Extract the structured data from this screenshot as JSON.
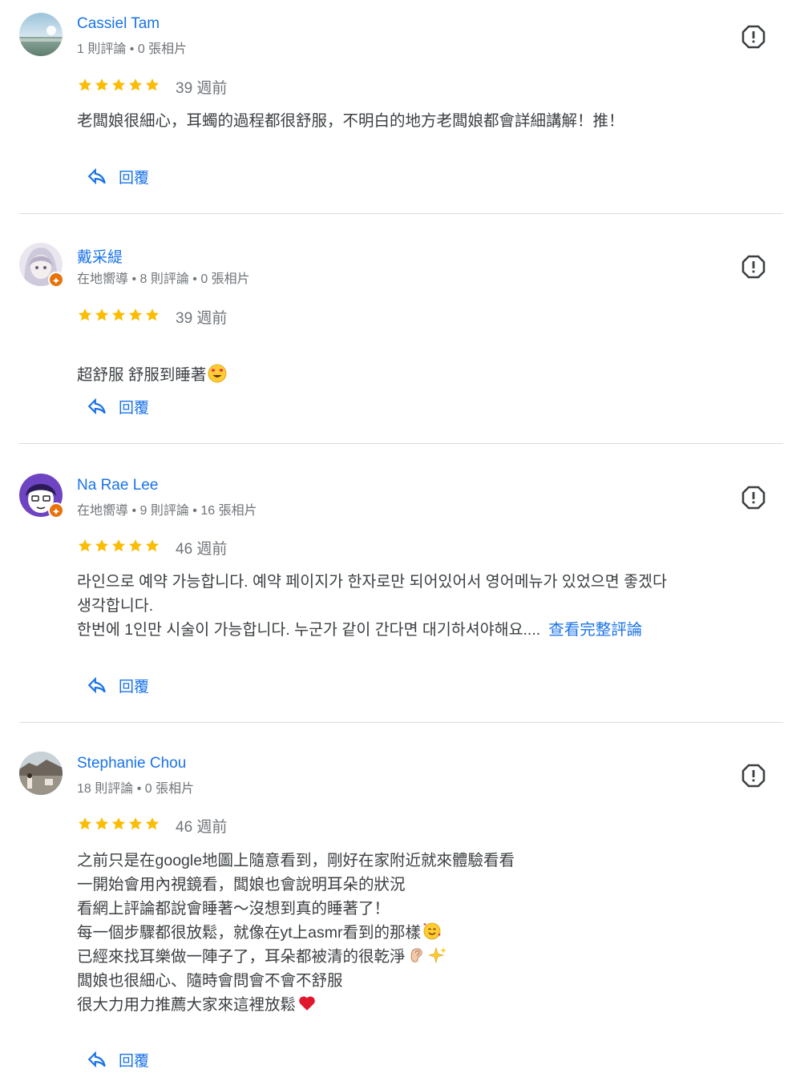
{
  "reviews": [
    {
      "author": "Cassiel Tam",
      "meta": "1 則評論 • 0 張相片",
      "rating": 5,
      "date": "39 週前",
      "text": "老闆娘很細心，耳蠋的過程都很舒服，不明白的地方老闆娘都會詳細講解！推！",
      "reply_label": "回覆"
    },
    {
      "author": "戴采緹",
      "meta": "在地嚮導 • 8 則評論 • 0 張相片",
      "rating": 5,
      "date": "39 週前",
      "text": "超舒服 舒服到睡著",
      "reply_label": "回覆"
    },
    {
      "author": "Na Rae Lee",
      "meta": "在地嚮導 • 9 則評論 • 16 張相片",
      "rating": 5,
      "date": "46 週前",
      "text": "라인으로 예약 가능합니다. 예약 페이지가 한자로만 되어있어서 영어메뉴가 있었으면 좋겠다\n생각합니다.\n한번에 1인만 시술이 가능합니다. 누군가 같이 간다면 대기하셔야해요....",
      "more_label": "查看完整評論",
      "reply_label": "回覆"
    },
    {
      "author": "Stephanie Chou",
      "meta": "18 則評論 • 0 張相片",
      "rating": 5,
      "date": "46 週前",
      "lines": [
        "之前只是在google地圖上隨意看到，剛好在家附近就來體驗看看",
        "一開始會用內視鏡看，闆娘也會說明耳朵的狀況",
        "看網上評論都說會睡著～沒想到真的睡著了！",
        "每一個步驟都很放鬆，就像在yt上asmr看到的那樣",
        "已經來找耳樂做一陣子了，耳朵都被清的很乾淨",
        "闆娘也很細心、隨時會問會不會不舒服",
        "很大力用力推薦大家來這裡放鬆"
      ],
      "reply_label": "回覆"
    }
  ],
  "colors": {
    "accent": "#1a73e8",
    "star": "#fbbc04",
    "meta": "#70757a",
    "text": "#3c4043",
    "guide_badge": "#e8710a"
  },
  "icons": {
    "flag": "report-icon",
    "reply": "reply-arrow-icon",
    "star": "star-icon",
    "guide": "local-guide-badge-icon"
  }
}
